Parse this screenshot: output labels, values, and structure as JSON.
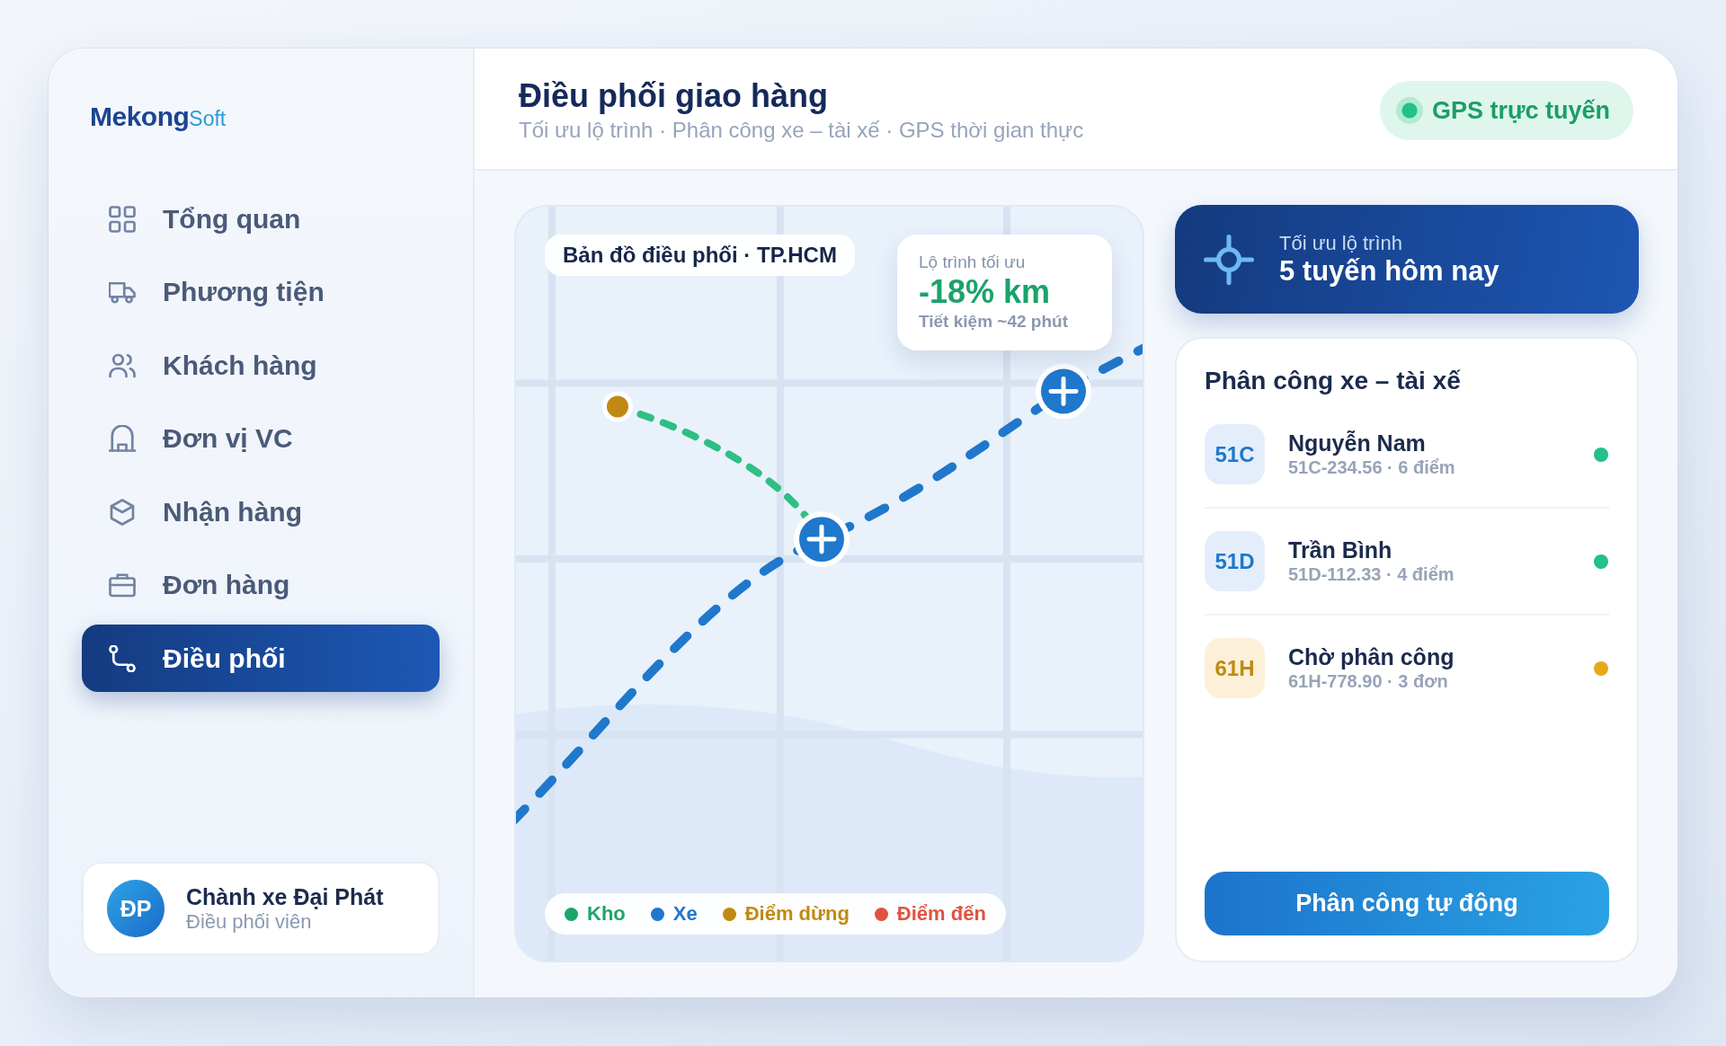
{
  "brand": {
    "name": "Mekong",
    "suffix": "Soft"
  },
  "nav": [
    {
      "label": "Tổng quan",
      "selected": false
    },
    {
      "label": "Phương tiện",
      "selected": false
    },
    {
      "label": "Khách hàng",
      "selected": false
    },
    {
      "label": "Đơn vị VC",
      "selected": false
    },
    {
      "label": "Nhận hàng",
      "selected": false
    },
    {
      "label": "Đơn hàng",
      "selected": false
    },
    {
      "label": "Điều phối",
      "selected": true
    }
  ],
  "user": {
    "initials": "ĐP",
    "name": "Chành xe Đại Phát",
    "role": "Điều phối viên"
  },
  "header": {
    "title": "Điều phối giao hàng",
    "subtitle": "Tối ưu lộ trình · Phân công xe – tài xế · GPS thời gian thực",
    "status": {
      "label": "GPS trực tuyến",
      "online": true
    }
  },
  "map": {
    "title": "Bản đồ điều phối · TP.HCM",
    "stat": {
      "label": "Lộ trình tối ưu",
      "value": "-18% km",
      "note": "Tiết kiệm ~42 phút"
    },
    "legend": [
      {
        "label": "Kho",
        "color": "#1ba56b"
      },
      {
        "label": "Xe",
        "color": "#1f78cc"
      },
      {
        "label": "Điểm dừng",
        "color": "#c08a12"
      },
      {
        "label": "Điểm đến",
        "color": "#e0533f"
      }
    ]
  },
  "summary": {
    "label": "Tối ưu lộ trình",
    "value": "5 tuyến hôm nay"
  },
  "assignments": {
    "title": "Phân công xe – tài xế",
    "rows": [
      {
        "badge": "51C",
        "name": "Nguyễn Nam",
        "detail": "51C-234.56 · 6 điểm",
        "kind": "assigned",
        "color": "#22c08a"
      },
      {
        "badge": "51D",
        "name": "Trần Bình",
        "detail": "51D-112.33 · 4 điểm",
        "kind": "assigned",
        "color": "#22c08a"
      },
      {
        "badge": "61H",
        "name": "Chờ phân công",
        "detail": "61H-778.90 · 3 đơn",
        "kind": "pending",
        "color": "#e5a91a"
      }
    ],
    "button": "Phân công tự động"
  }
}
